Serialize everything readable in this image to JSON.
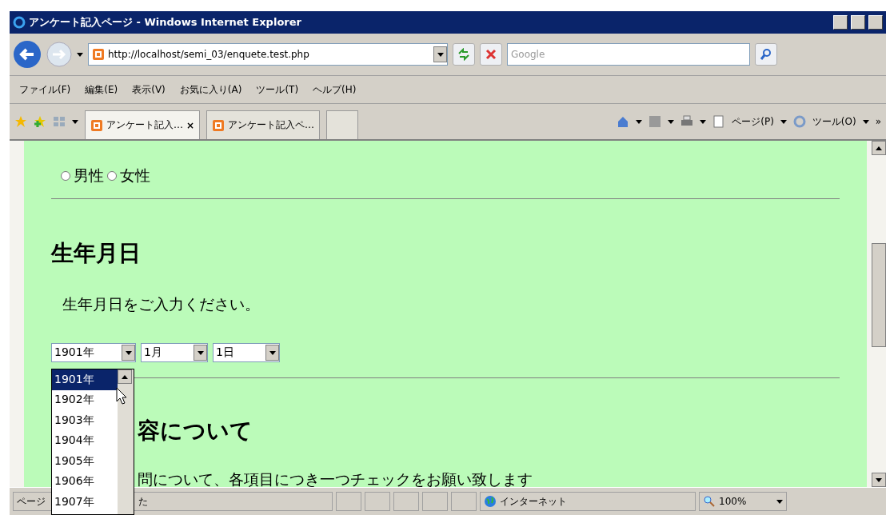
{
  "window": {
    "title": "アンケート記入ページ - Windows Internet Explorer"
  },
  "address": {
    "value": "http://localhost/semi_03/enquete.test.php"
  },
  "search": {
    "placeholder": "Google"
  },
  "menu": [
    "ファイル(F)",
    "編集(E)",
    "表示(V)",
    "お気に入り(A)",
    "ツール(T)",
    "ヘルプ(H)"
  ],
  "tabs": [
    {
      "label": "アンケート記入…",
      "selected": true,
      "close": "×"
    },
    {
      "label": "アンケート記入ペ…",
      "selected": false
    }
  ],
  "command_bar": [
    "ページ(P)",
    "ツール(O)"
  ],
  "overflow": "»",
  "page": {
    "gender": [
      {
        "label": "男性",
        "selected": false
      },
      {
        "label": "女性",
        "selected": false
      }
    ],
    "birth_heading": "生年月日",
    "birth_text": "生年月日をご入力ください。",
    "selects": [
      "1901年",
      "1月",
      "1日"
    ],
    "content_heading": "容について",
    "content_text": "問について、各項目につき一つチェックをお願い致します"
  },
  "dropdown": [
    {
      "label": "1901年",
      "selected": true
    },
    {
      "label": "1902年",
      "selected": false
    },
    {
      "label": "1903年",
      "selected": false
    },
    {
      "label": "1904年",
      "selected": false
    },
    {
      "label": "1905年",
      "selected": false
    },
    {
      "label": "1906年",
      "selected": false
    },
    {
      "label": "1907年",
      "selected": false
    }
  ],
  "status_bar": {
    "left": [
      "ページ",
      "た"
    ],
    "zone": "インターネット",
    "zoom": "100%"
  }
}
